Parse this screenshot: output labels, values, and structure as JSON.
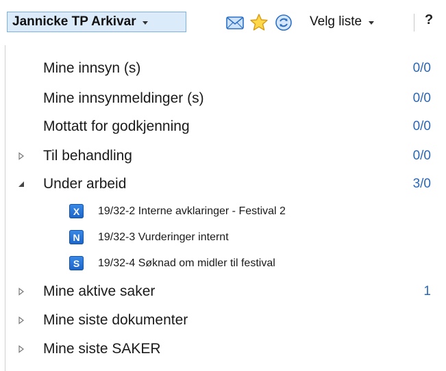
{
  "toolbar": {
    "user_label": "Jannicke TP Arkivar",
    "list_label": "Velg liste",
    "help_label": "?",
    "icons": [
      "mail-icon",
      "star-icon",
      "refresh-icon"
    ]
  },
  "list": {
    "items": [
      {
        "label": "Mine innsyn (s)",
        "count": "0/0"
      },
      {
        "label": "Mine innsynmeldinger (s)",
        "count": "0/0"
      },
      {
        "label": "Mottatt for godkjenning",
        "count": "0/0"
      },
      {
        "label": "Til behandling",
        "count": "0/0",
        "expander": "collapsed"
      },
      {
        "label": "Under arbeid",
        "count": "3/0",
        "expander": "expanded"
      },
      {
        "label": "Mine aktive saker",
        "count": "1",
        "expander": "collapsed"
      },
      {
        "label": "Mine siste dokumenter",
        "count": "",
        "expander": "collapsed"
      },
      {
        "label": "Mine siste SAKER",
        "count": "",
        "expander": "collapsed"
      }
    ],
    "under_arbeid_docs": [
      {
        "badge": "X",
        "title": "19/32-2 Interne avklaringer - Festival 2"
      },
      {
        "badge": "N",
        "title": "19/32-3 Vurderinger internt"
      },
      {
        "badge": "S",
        "title": "19/32-4 Søknad om midler til festival"
      }
    ]
  },
  "colors": {
    "count": "#2a66b8",
    "badge": "#1b63c8",
    "user_button_bg": "#dcebfa"
  }
}
